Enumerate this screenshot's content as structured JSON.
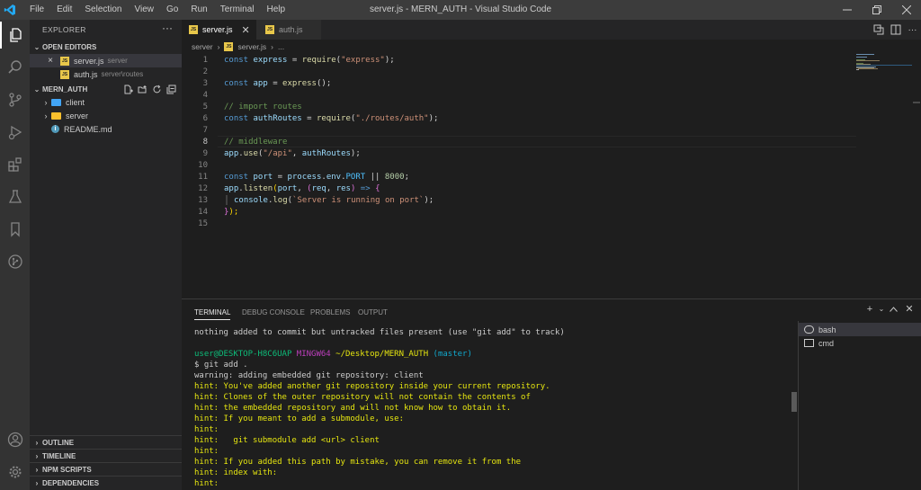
{
  "titlebar": {
    "menu": [
      "File",
      "Edit",
      "Selection",
      "View",
      "Go",
      "Run",
      "Terminal",
      "Help"
    ],
    "window_title": "server.js - MERN_AUTH - Visual Studio Code"
  },
  "sidebar": {
    "title": "EXPLORER",
    "more": "···",
    "open_editors": {
      "label": "OPEN EDITORS",
      "items": [
        {
          "name": "server.js",
          "desc": "server",
          "badge": "JS"
        },
        {
          "name": "auth.js",
          "desc": "server\\routes",
          "badge": "JS"
        }
      ]
    },
    "project": {
      "label": "MERN_AUTH",
      "items": [
        {
          "name": "client",
          "type": "folder",
          "color": "#42a5f5"
        },
        {
          "name": "server",
          "type": "folder",
          "color": "#fbc02d"
        },
        {
          "name": "README.md",
          "type": "info",
          "icon": "i"
        }
      ]
    },
    "bottom_sections": [
      "OUTLINE",
      "TIMELINE",
      "NPM SCRIPTS",
      "DEPENDENCIES"
    ]
  },
  "tabs": [
    {
      "label": "server.js",
      "active": true,
      "badge": "JS"
    },
    {
      "label": "auth.js",
      "active": false,
      "badge": "JS"
    }
  ],
  "breadcrumb": {
    "folder": "server",
    "file": "server.js",
    "rest": "...",
    "badge": "JS"
  },
  "editor": {
    "line_numbers": [
      "1",
      "2",
      "3",
      "4",
      "5",
      "6",
      "7",
      "8",
      "9",
      "10",
      "11",
      "12",
      "13",
      "14",
      "15"
    ],
    "current_line": 8,
    "code": {
      "l1": {
        "kw": "const",
        "var": "express",
        "eq": " = ",
        "fn": "require",
        "po": "(",
        "str": "\"express\"",
        "pc": ");"
      },
      "l3": {
        "kw": "const",
        "var": "app",
        "eq": " = ",
        "fn": "express",
        "rest": "();"
      },
      "l5": {
        "comment": "// import routes"
      },
      "l6": {
        "kw": "const",
        "var": "authRoutes",
        "eq": " = ",
        "fn": "require",
        "po": "(",
        "str": "\"./routes/auth\"",
        "pc": ");"
      },
      "l8": {
        "comment": "// middleware"
      },
      "l9": {
        "obj": "app",
        "dot": ".",
        "fn": "use",
        "po": "(",
        "str": "\"/api\"",
        "comma": ", ",
        "arg": "authRoutes",
        "pc": ");"
      },
      "l11": {
        "kw": "const",
        "var": "port",
        "eq": " = ",
        "obj": "process",
        "dot1": ".",
        "prop": "env",
        "dot2": ".",
        "cst": "PORT",
        "or": " || ",
        "num": "8000",
        "semi": ";"
      },
      "l12": {
        "obj": "app",
        "dot": ".",
        "fn": "listen",
        "po": "(",
        "arg1": "port",
        "comma": ", ",
        "po2": "(",
        "arg2": "req",
        "comma2": ", ",
        "arg3": "res",
        "pc2": ")",
        "arrow": " => ",
        "kw": "",
        "brace": "{"
      },
      "l13": {
        "obj": "console",
        "dot": ".",
        "fn": "log",
        "po": "(",
        "str": "`Server is running on port`",
        "pc": ");"
      },
      "l14": {
        "brace": "}",
        "pc": ");"
      }
    }
  },
  "panel": {
    "tabs": [
      "TERMINAL",
      "DEBUG CONSOLE",
      "PROBLEMS",
      "OUTPUT"
    ],
    "terminal_lines": [
      "nothing added to commit but untracked files present (use \"git add\" to track)",
      "",
      "",
      "$ git add .",
      "warning: adding embedded git repository: client",
      "hint: You've added another git repository inside your current repository.",
      "hint: Clones of the outer repository will not contain the contents of",
      "hint: the embedded repository and will not know how to obtain it.",
      "hint: If you meant to add a submodule, use:",
      "hint:",
      "hint:   git submodule add <url> client",
      "hint:",
      "hint: If you added this path by mistake, you can remove it from the",
      "hint: index with:",
      "hint:"
    ],
    "prompt": {
      "user": "user@DESKTOP-H8C6UAP",
      "sys": "MINGW64",
      "path": "~/Desktop/MERN_AUTH",
      "branch": "(master)"
    },
    "terminals": [
      {
        "label": "bash",
        "active": true
      },
      {
        "label": "cmd",
        "active": false
      }
    ]
  }
}
